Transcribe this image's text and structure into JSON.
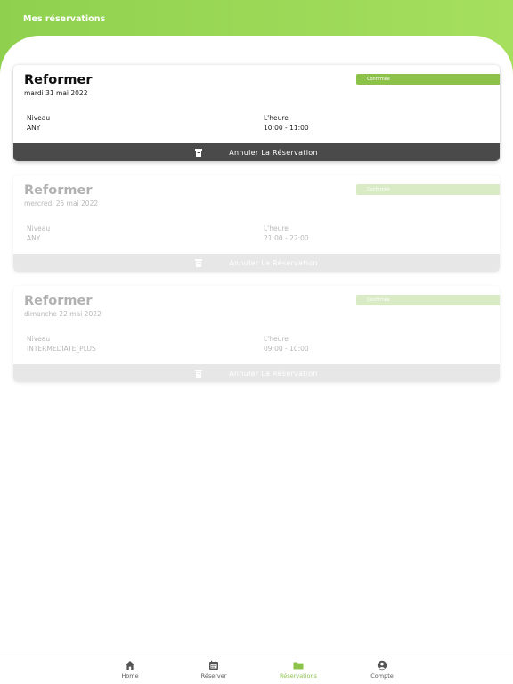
{
  "header": {
    "title": "Mes réservations"
  },
  "reservations": [
    {
      "title": "Reformer",
      "date": "mardi 31 mai 2022",
      "badge": "Confirmée",
      "level_label": "Niveau",
      "level": "ANY",
      "time_label": "L'heure",
      "time": "10:00 - 11:00",
      "cancel_label": "Annuler La Réservation"
    },
    {
      "title": "Reformer",
      "date": "mercredi 25 mai 2022",
      "badge": "Confirmée",
      "level_label": "Niveau",
      "level": "ANY",
      "time_label": "L'heure",
      "time": "21:00 - 22:00",
      "cancel_label": "Annuler La Réservation"
    },
    {
      "title": "Reformer",
      "date": "dimanche 22 mai 2022",
      "badge": "Confirmée",
      "level_label": "Niveau",
      "level": "INTERMEDIATE_PLUS",
      "time_label": "L'heure",
      "time": "09:00 - 10:00",
      "cancel_label": "Annuler La Réservation"
    }
  ],
  "nav": {
    "home": "Home",
    "book": "Réserver",
    "reservations": "Réservations",
    "account": "Compte"
  },
  "colors": {
    "accent": "#8cc24a",
    "header_gradient_start": "#8fd14f",
    "header_gradient_end": "#a6df5e",
    "cancel_bar": "#4a4a4a"
  },
  "icons": {
    "home": "home-icon",
    "book": "calendar-icon",
    "reservations": "folder-icon",
    "account": "user-circle-icon",
    "cancel": "trash-icon"
  }
}
